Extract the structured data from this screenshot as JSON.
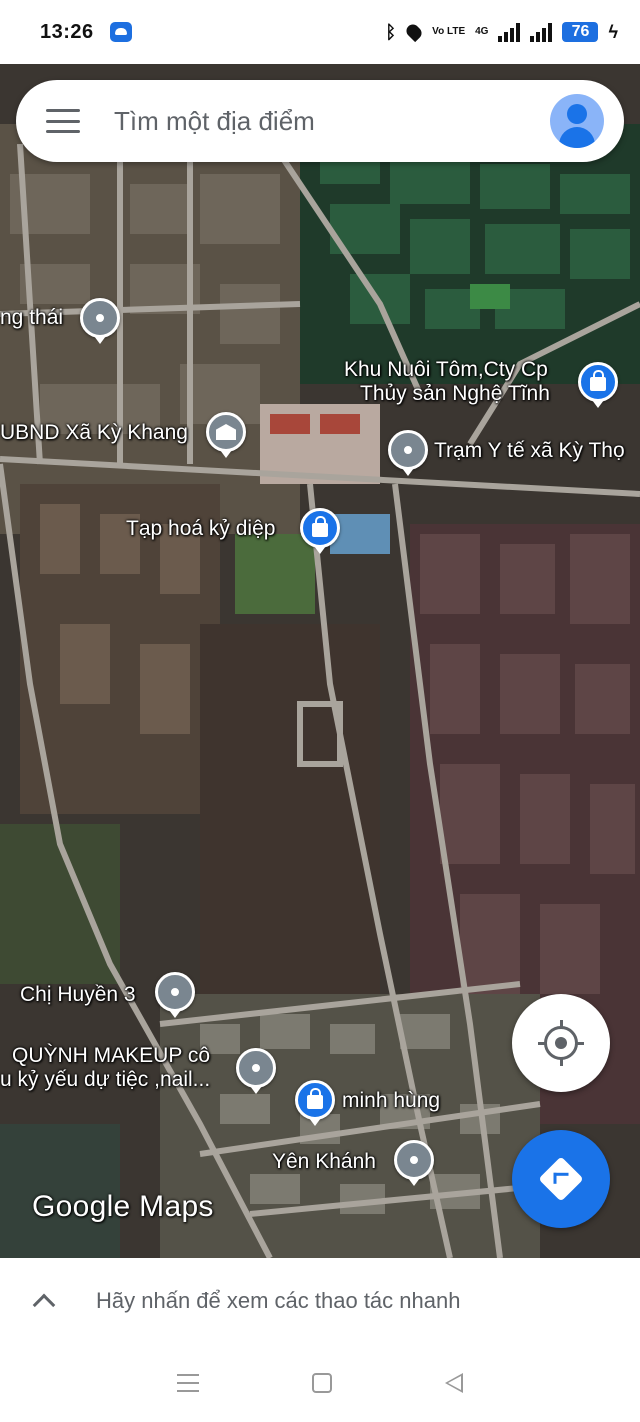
{
  "status_bar": {
    "time": "13:26",
    "network_text": "Vo LTE",
    "network_gen": "4G",
    "battery": "76"
  },
  "search": {
    "placeholder": "Tìm một địa điểm"
  },
  "places": [
    {
      "name": "ng thái",
      "pin": "place"
    },
    {
      "name": "Khu Nuôi Tôm,Cty Cp",
      "line2": "Thủy sản Nghệ Tĩnh",
      "pin": "shop"
    },
    {
      "name": "UBND Xã Kỳ Khang",
      "pin": "government"
    },
    {
      "name": "Trạm Y tế xã Kỳ Thọ",
      "pin": "place"
    },
    {
      "name": "Tạp hoá kỷ diệp",
      "pin": "shop"
    },
    {
      "name": "Chị Huyền 3",
      "pin": "place"
    },
    {
      "name": "QUỲNH MAKEUP cô",
      "line2": "u kỷ yếu dự tiệc ,nail...",
      "pin": "place"
    },
    {
      "name": "minh hùng",
      "pin": "shop"
    },
    {
      "name": "Yên Khánh",
      "pin": "place"
    }
  ],
  "map_logo": "Google Maps",
  "bottom_sheet": {
    "hint": "Hãy nhấn để xem các thao tác nhanh"
  },
  "colors": {
    "accent": "#1a73e8",
    "pin_grey": "#7a8690",
    "road": "#a9a49c"
  }
}
